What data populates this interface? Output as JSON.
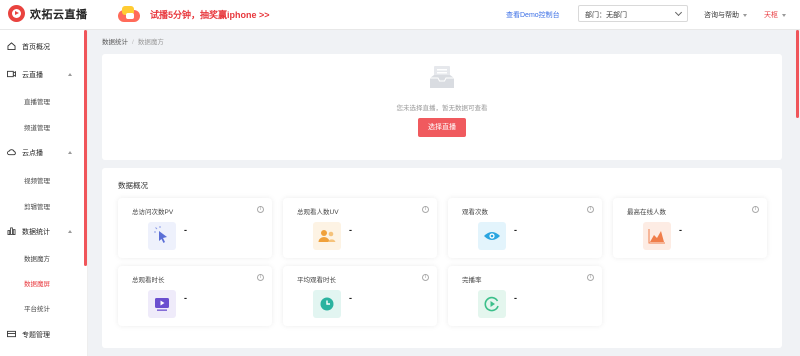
{
  "header": {
    "brand": "欢拓云直播",
    "promo": "试播5分钟，抽奖赢iphone >>",
    "demo_link": "查看Demo控制台",
    "dept_label": "部门：无部门",
    "help": "咨询与帮助",
    "user": "天枢"
  },
  "sidebar": {
    "home": "首页概况",
    "live": {
      "label": "云直播",
      "items": [
        "直播管理",
        "频道管理"
      ]
    },
    "vod": {
      "label": "云点播",
      "items": [
        "视频管理",
        "剪辑管理"
      ]
    },
    "stats": {
      "label": "数据统计",
      "items": [
        "数据魔方",
        "数据魔屏",
        "平台统计"
      ]
    },
    "topic": "专题管理",
    "active_item": "数据魔屏"
  },
  "breadcrumb": {
    "root": "数据统计",
    "separator": "/",
    "current": "数据魔方"
  },
  "empty": {
    "message": "您未选择直播，暂无数据可查看",
    "button": "选择直播"
  },
  "overview": {
    "title": "数据概况",
    "cards": [
      {
        "label": "总访问次数PV",
        "value": "-",
        "icon": "cursor-click-icon",
        "color": "#5b6fd6",
        "bg": "#eef1fc"
      },
      {
        "label": "总观看人数UV",
        "value": "-",
        "icon": "users-icon",
        "color": "#f0a13b",
        "bg": "#fdf3e4"
      },
      {
        "label": "观看次数",
        "value": "-",
        "icon": "eye-icon",
        "color": "#2aa5e0",
        "bg": "#e3f4fc"
      },
      {
        "label": "最高在线人数",
        "value": "-",
        "icon": "area-chart-icon",
        "color": "#f07e4b",
        "bg": "#fdece4"
      },
      {
        "label": "总观看时长",
        "value": "-",
        "icon": "play-screen-icon",
        "color": "#6b4fcf",
        "bg": "#efebfa"
      },
      {
        "label": "平均观看时长",
        "value": "-",
        "icon": "clock-icon",
        "color": "#2bb3a0",
        "bg": "#e2f5f1"
      },
      {
        "label": "完播率",
        "value": "-",
        "icon": "play-circle-icon",
        "color": "#3bbf8a",
        "bg": "#e4f6ee"
      }
    ]
  },
  "colors": {
    "accent": "#f05a5e",
    "link": "#3b6fe6"
  }
}
